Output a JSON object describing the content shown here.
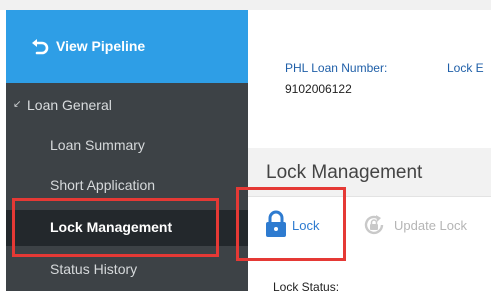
{
  "sidebar": {
    "pipeline_label": "View Pipeline",
    "section_label": "Loan General",
    "items": [
      {
        "label": "Loan Summary"
      },
      {
        "label": "Short Application"
      },
      {
        "label": "Lock Management"
      },
      {
        "label": "Status History"
      }
    ]
  },
  "loan": {
    "number_label": "PHL Loan Number:",
    "number_value": "9102006122",
    "lock_label_partial": "Lock E"
  },
  "main": {
    "section_title": "Lock Management",
    "toolbar": {
      "lock_label": "Lock",
      "update_lock_label": "Update Lock"
    },
    "lock_status_label": "Lock Status:"
  },
  "colors": {
    "sidebar_bg": "#3d4246",
    "pipeline_bg": "#2e9ee6",
    "active_bg": "#23282c",
    "highlight": "#e53935",
    "link_blue": "#2e7bd0"
  }
}
